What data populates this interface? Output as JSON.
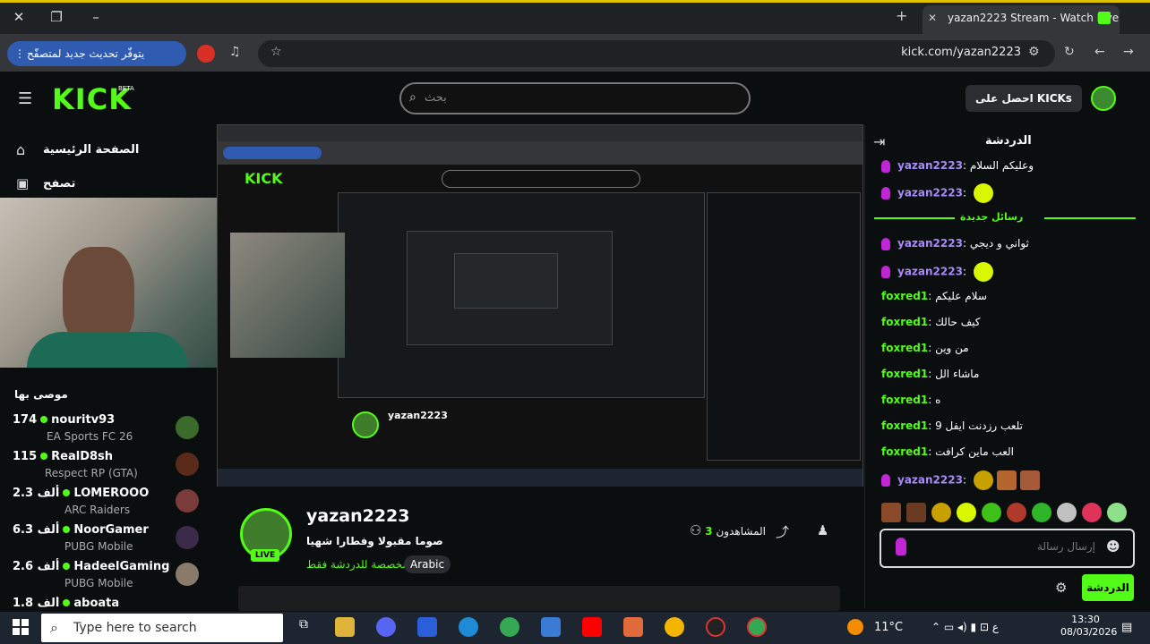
{
  "browser": {
    "tab_title": "yazan2223 Stream - Watch Live",
    "update_banner": "يتوفّر تحديث جديد لمتصفّح Chrome",
    "url": "kick.com/yazan2223"
  },
  "header": {
    "logo": "KICK",
    "beta": "BETA",
    "search_placeholder": "بحث",
    "get_kicks": "احصل على KICKs"
  },
  "sidebar": {
    "nav": [
      {
        "label": "الصفحة الرئيسية",
        "icon": "home-icon"
      },
      {
        "label": "تصفح",
        "icon": "browse-icon"
      }
    ],
    "recommended_title": "موصى بها",
    "recommended": [
      {
        "viewers": "174",
        "name": "nouritv93",
        "game": "EA Sports FC 26",
        "color": "#3b6b2a"
      },
      {
        "viewers": "115",
        "name": "RealD8sh",
        "game": "Respect RP (GTA)",
        "color": "#5a2a1a"
      },
      {
        "viewers": "2.3 ألف",
        "name": "LOMEROOO",
        "game": "ARC Raiders",
        "color": "#7a3b3b"
      },
      {
        "viewers": "6.3 ألف",
        "name": "NoorGamer",
        "game": "PUBG Mobile",
        "color": "#3b2a4a"
      },
      {
        "viewers": "2.6 ألف",
        "name": "HadeelGaming",
        "game": "PUBG Mobile",
        "color": "#8a7a6a"
      },
      {
        "viewers": "1.8 ألف",
        "name": "aboata",
        "game": "",
        "color": "#333"
      }
    ]
  },
  "channel": {
    "name": "yazan2223",
    "live": "LIVE",
    "title": "صوما مقبولا وفطارا شهيا",
    "tag_chat": "مخصصة للدردشة فقط",
    "tag_lang": "Arabic",
    "viewers_label": "المشاهدون",
    "viewers_count": "3"
  },
  "chat": {
    "title": "الدردشة",
    "new_messages": "رسائل جديدة",
    "messages": [
      {
        "user": "yazan2223",
        "text": "وعليكم السلام",
        "type": "y"
      },
      {
        "user": "yazan2223",
        "text": "",
        "type": "y",
        "emoji": true
      },
      {
        "user": "yazan2223",
        "text": "ثواني و ديجي",
        "type": "y"
      },
      {
        "user": "yazan2223",
        "text": "",
        "type": "y",
        "emoji": true
      },
      {
        "user": "foxred1",
        "text": "سلام عليكم",
        "type": "f"
      },
      {
        "user": "foxred1",
        "text": "كيف حالك",
        "type": "f"
      },
      {
        "user": "foxred1",
        "text": "من وين",
        "type": "f"
      },
      {
        "user": "foxred1",
        "text": "ماشاء الل",
        "type": "f"
      },
      {
        "user": "foxred1",
        "text": "ه",
        "type": "f"
      },
      {
        "user": "foxred1",
        "text": "تلعب رزدنت ايفل 9",
        "type": "f"
      },
      {
        "user": "foxred1",
        "text": "العب ماين كرافت",
        "type": "f"
      },
      {
        "user": "yazan2223",
        "text": "",
        "type": "y",
        "emoji": true
      }
    ],
    "input_placeholder": "إرسال رسالة",
    "send": "الدردشة"
  },
  "taskbar": {
    "search": "Type here to search",
    "temperature": "11°C",
    "time": "13:30",
    "date": "08/03/2026"
  }
}
